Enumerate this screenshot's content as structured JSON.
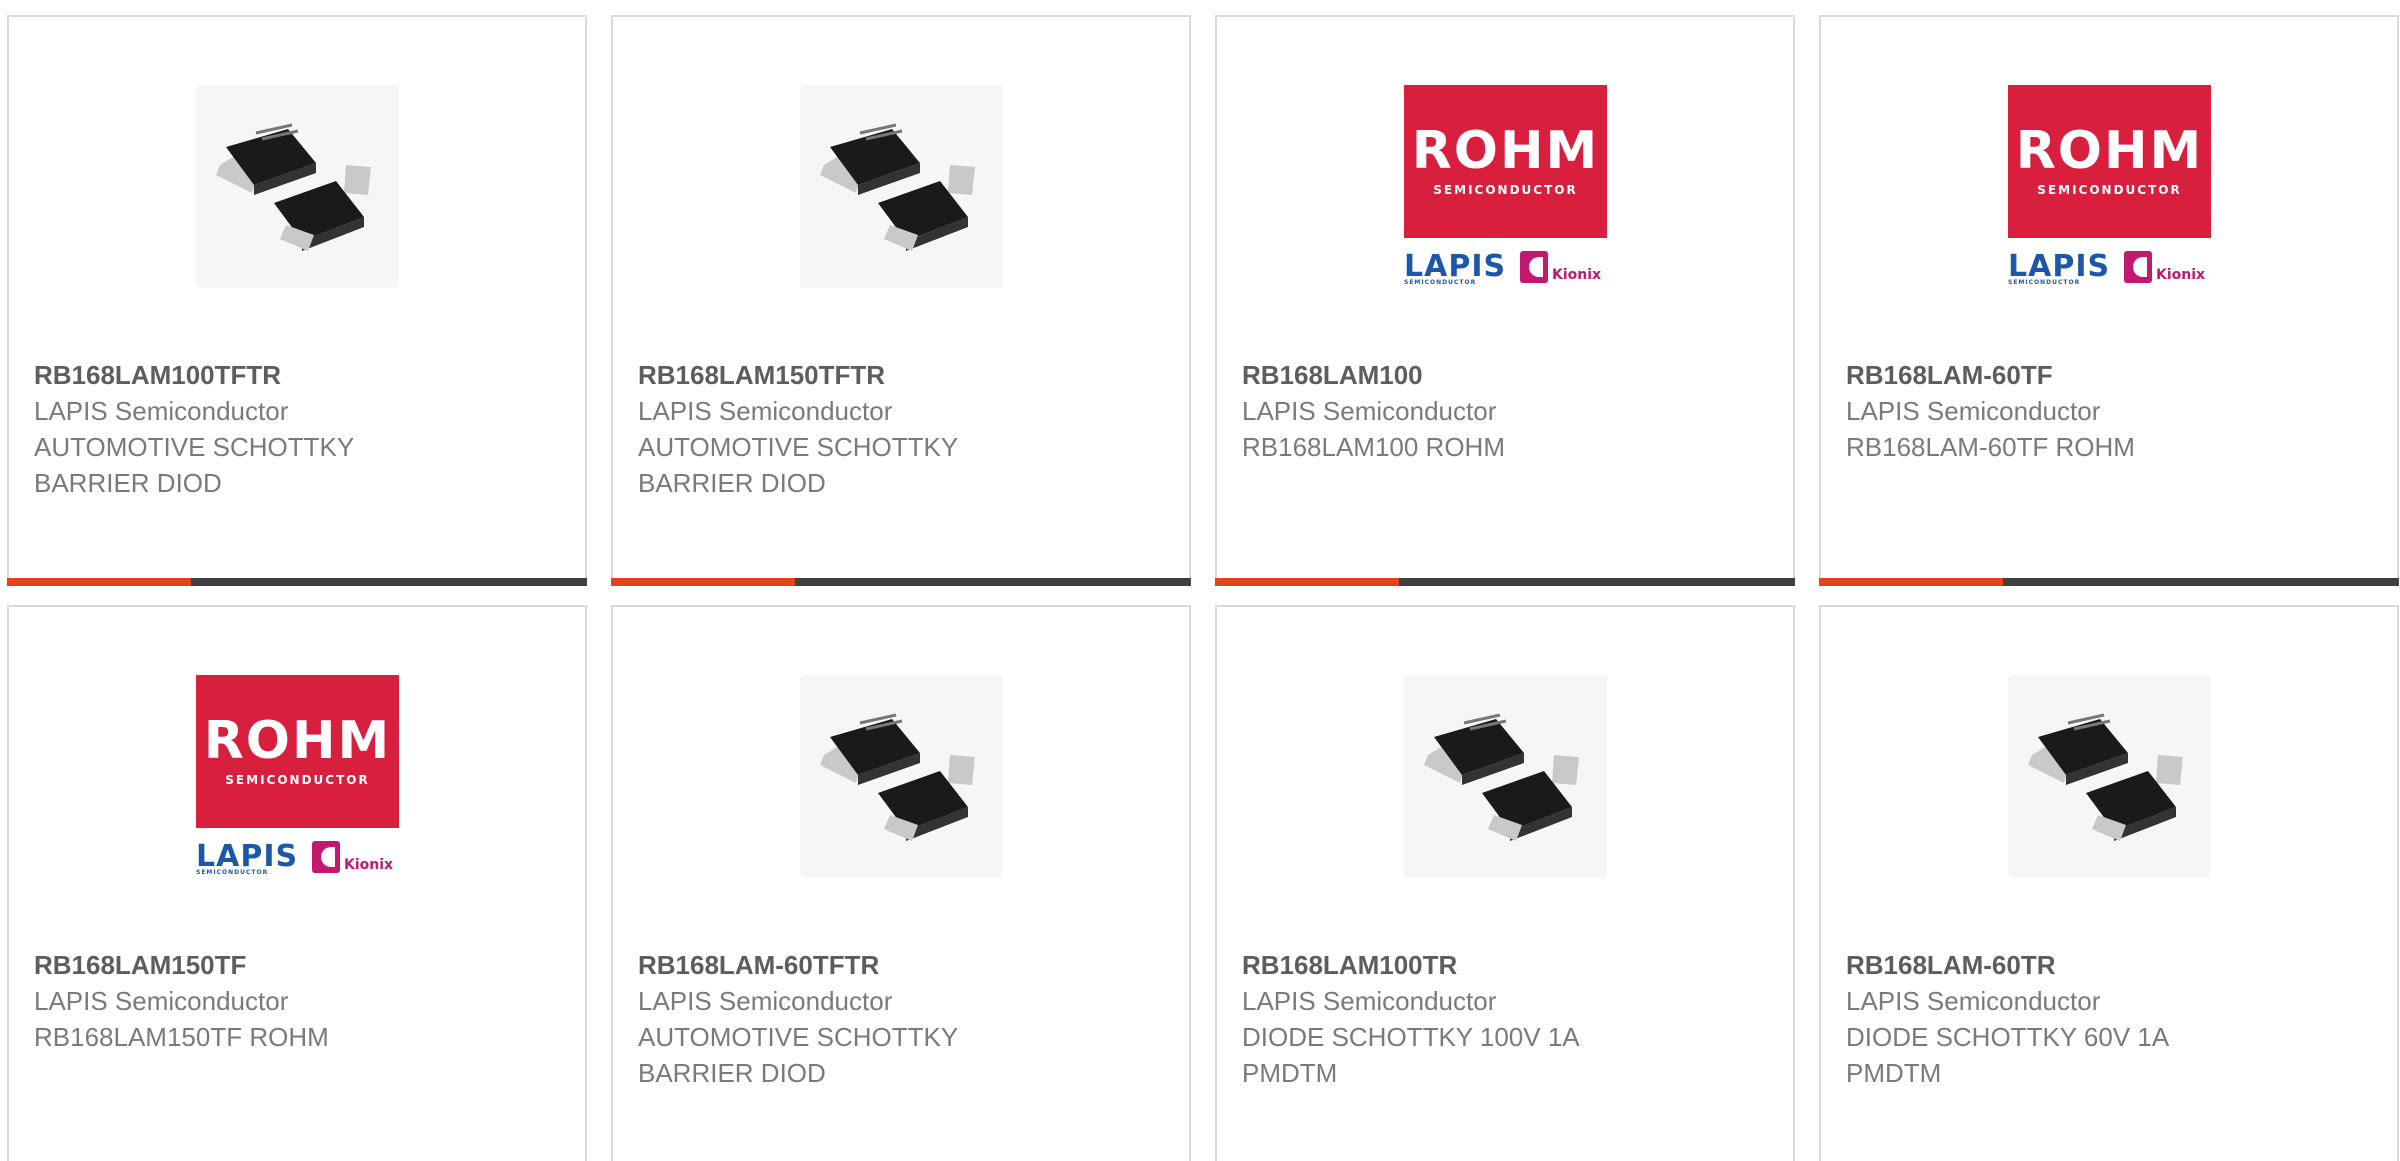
{
  "colors": {
    "accent": "#e6401c",
    "bar": "#3f3f3f",
    "border": "#d9d9d9",
    "rohm_red": "#d81f3e",
    "lapis_blue": "#1d58a8",
    "kionix_magenta": "#c2186d"
  },
  "logo_text": {
    "rohm": "ROHM",
    "rohm_sub": "SEMICONDUCTOR",
    "lapis": "LAPIS",
    "lapis_sub": "SEMICONDUCTOR",
    "kionix": "Kionix"
  },
  "products": [
    {
      "part": "RB168LAM100TFTR",
      "manufacturer": "LAPIS Semiconductor",
      "desc1": "AUTOMOTIVE SCHOTTKY",
      "desc2": "BARRIER DIOD",
      "image": "diode-package-photo"
    },
    {
      "part": "RB168LAM150TFTR",
      "manufacturer": "LAPIS Semiconductor",
      "desc1": "AUTOMOTIVE SCHOTTKY",
      "desc2": "BARRIER DIOD",
      "image": "diode-package-photo"
    },
    {
      "part": "RB168LAM100",
      "manufacturer": "LAPIS Semiconductor",
      "desc1": "RB168LAM100 ROHM",
      "desc2": "",
      "image": "rohm-lapis-logo"
    },
    {
      "part": "RB168LAM-60TF",
      "manufacturer": "LAPIS Semiconductor",
      "desc1": "RB168LAM-60TF ROHM",
      "desc2": "",
      "image": "rohm-lapis-logo"
    },
    {
      "part": "RB168LAM150TF",
      "manufacturer": "LAPIS Semiconductor",
      "desc1": "RB168LAM150TF ROHM",
      "desc2": "",
      "image": "rohm-lapis-logo"
    },
    {
      "part": "RB168LAM-60TFTR",
      "manufacturer": "LAPIS Semiconductor",
      "desc1": "AUTOMOTIVE SCHOTTKY",
      "desc2": "BARRIER DIOD",
      "image": "diode-package-photo"
    },
    {
      "part": "RB168LAM100TR",
      "manufacturer": "LAPIS Semiconductor",
      "desc1": "DIODE SCHOTTKY 100V 1A",
      "desc2": "PMDTM",
      "image": "diode-package-photo"
    },
    {
      "part": "RB168LAM-60TR",
      "manufacturer": "LAPIS Semiconductor",
      "desc1": "DIODE SCHOTTKY 60V 1A",
      "desc2": "PMDTM",
      "image": "diode-package-photo"
    }
  ]
}
